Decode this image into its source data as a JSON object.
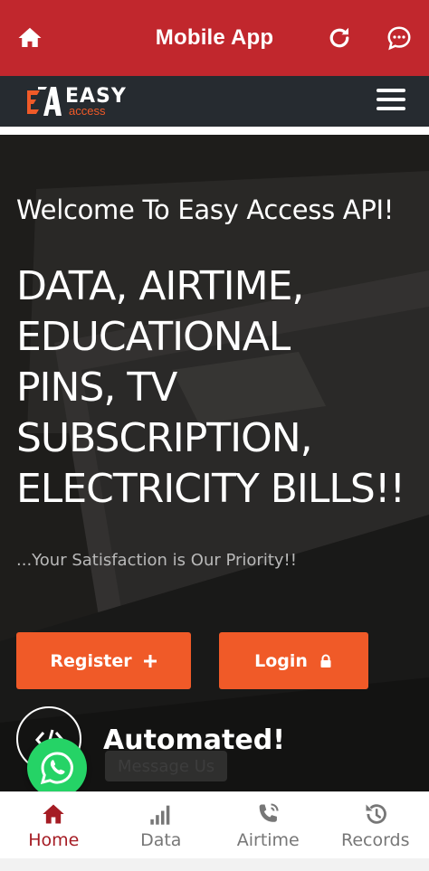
{
  "appbar": {
    "title": "Mobile App",
    "icons": [
      "home-icon",
      "reload-icon",
      "chat-bubble-icon"
    ],
    "color": "#c1272d"
  },
  "site_header": {
    "logo_word": "EASY",
    "logo_sub": "access",
    "menu_icon": "hamburger-menu-icon",
    "background": "#262b30"
  },
  "hero": {
    "welcome": "Welcome To Easy Access API!",
    "headline_lines": [
      "DATA, AIRTIME,",
      "EDUCATIONAL",
      "PINS, TV",
      "SUBSCRIPTION,",
      "ELECTRICITY BILLS!!"
    ],
    "tagline": "...Your Satisfaction is Our Priority!!",
    "register_label": "Register",
    "login_label": "Login",
    "feature_title": "Automated!",
    "message_us": "Message Us",
    "accent": "#f05a28"
  },
  "bottom_nav": {
    "items": [
      {
        "label": "Home",
        "icon": "home-icon",
        "active": true
      },
      {
        "label": "Data",
        "icon": "signal-bars-icon",
        "active": false
      },
      {
        "label": "Airtime",
        "icon": "phone-ringing-icon",
        "active": false
      },
      {
        "label": "Records",
        "icon": "history-icon",
        "active": false
      }
    ],
    "active_color": "#a51c24"
  }
}
